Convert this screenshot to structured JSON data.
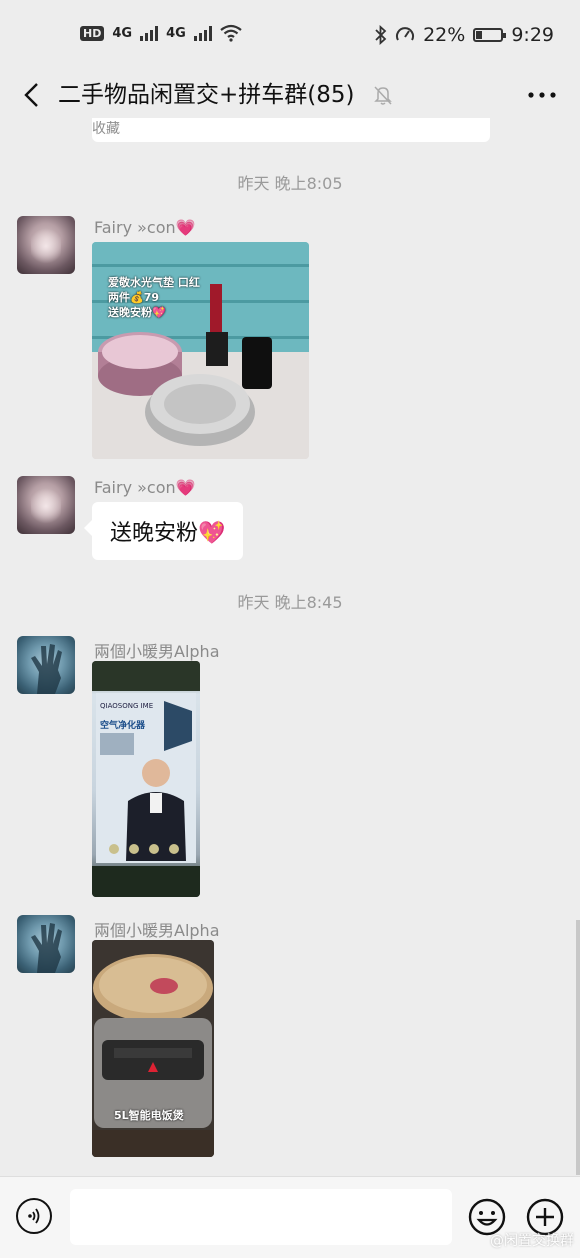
{
  "status_bar": {
    "hd_label": "HD",
    "network_1": "4G",
    "network_2": "4G",
    "battery_percent": "22%",
    "battery_level": 0.22,
    "time": "9:29"
  },
  "header": {
    "title": "二手物品闲置交+拼车群(85)"
  },
  "partial_message": {
    "text": "收藏"
  },
  "messages": [
    {
      "type": "timestamp",
      "text": "昨天 晚上8:05"
    },
    {
      "type": "image",
      "sender": "Fairy »con",
      "sender_emoji": "💗",
      "image_text": {
        "line1": "爱敬水光气垫   口红",
        "line2": "两件💰79",
        "line3": "送晚安粉💖"
      }
    },
    {
      "type": "text",
      "sender": "Fairy »con",
      "sender_emoji": "💗",
      "text": "送晚安粉💖"
    },
    {
      "type": "timestamp",
      "text": "昨天 晚上8:45"
    },
    {
      "type": "image",
      "sender": "兩個小暖男Alpha",
      "image_text": {
        "brand": "QIAOSONG IME",
        "headline": "空气净化器"
      }
    },
    {
      "type": "image",
      "sender": "兩個小暖男Alpha",
      "image_text": {
        "caption": "5L智能电饭煲"
      }
    }
  ],
  "input_bar": {
    "placeholder": ""
  },
  "watermark": "@闲置交换群"
}
